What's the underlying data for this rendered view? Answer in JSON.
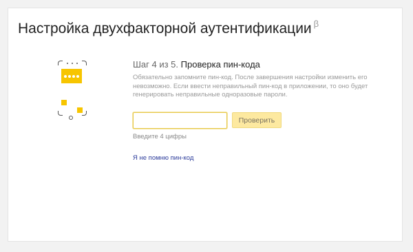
{
  "header": {
    "title": "Настройка двухфакторной аутентификации",
    "beta": "β"
  },
  "illustration": {
    "icons": [
      "phone-icon",
      "pin-code-icon",
      "home-button-icon"
    ],
    "accent_color": "#f7c500"
  },
  "step": {
    "prefix": "Шаг 4 из 5.",
    "title": "Проверка пин-кода",
    "description": "Обязательно запомните пин-код. После завершения настройки изменить его невозможно. Если ввести неправильный пин-код в приложении, то оно будет генерировать неправильные одноразовые пароли."
  },
  "form": {
    "pin_value": "",
    "pin_placeholder": "",
    "verify_label": "Проверить",
    "hint": "Введите 4 цифры",
    "forgot_link": "Я не помню пин-код"
  },
  "colors": {
    "button_bg": "#fde9a0",
    "link": "#2a3a9a"
  }
}
